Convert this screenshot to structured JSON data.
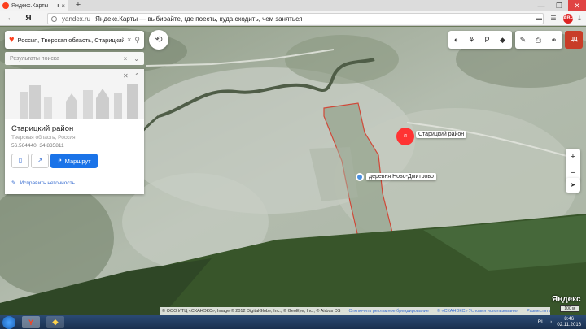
{
  "browser": {
    "tab_title": "Яндекс.Карты — выбир…",
    "tab_close": "×",
    "new_tab": "+",
    "window_buttons": [
      "—",
      "❐",
      "✕"
    ],
    "nav_back": "←",
    "yandex_button": "Я",
    "domain": "yandex.ru",
    "page_title": "Яндекс.Карты — выбирайте, где поесть, куда сходить, чем заняться"
  },
  "search": {
    "query": "Россия, Тверская область, Старицкий р",
    "clear": "×",
    "results_label": "Результаты поиска",
    "results_close": "×",
    "results_toggle": "⌄"
  },
  "place_card": {
    "name": "Старицкий район",
    "region": "Тверская область, Россия",
    "coords": "56.564440, 34.835811",
    "route_label": "Маршрут",
    "fix_label": "Исправить неточность"
  },
  "map_labels": {
    "district_marker": "Старицкий район",
    "district_pin": "я",
    "village": "деревня Ново-Дмитрово"
  },
  "toolbar": {
    "user_badge": "ЦЦ"
  },
  "map_footer": {
    "copyright": "© ООО ИТЦ «СКАНЭКС», Image © 2012 DigitalGlobe, Inc., © GeoEye, Inc., © Airbus DS",
    "ad_link": "Отключить рекламное брендирование",
    "terms": "© «СКАНЭКС» Условия использования",
    "report": "Разместить рекламу",
    "logo": "Яндекс",
    "scale": "100 м"
  },
  "taskbar": {
    "lang": "RU",
    "time": "8:46",
    "date": "02.11.2016"
  }
}
